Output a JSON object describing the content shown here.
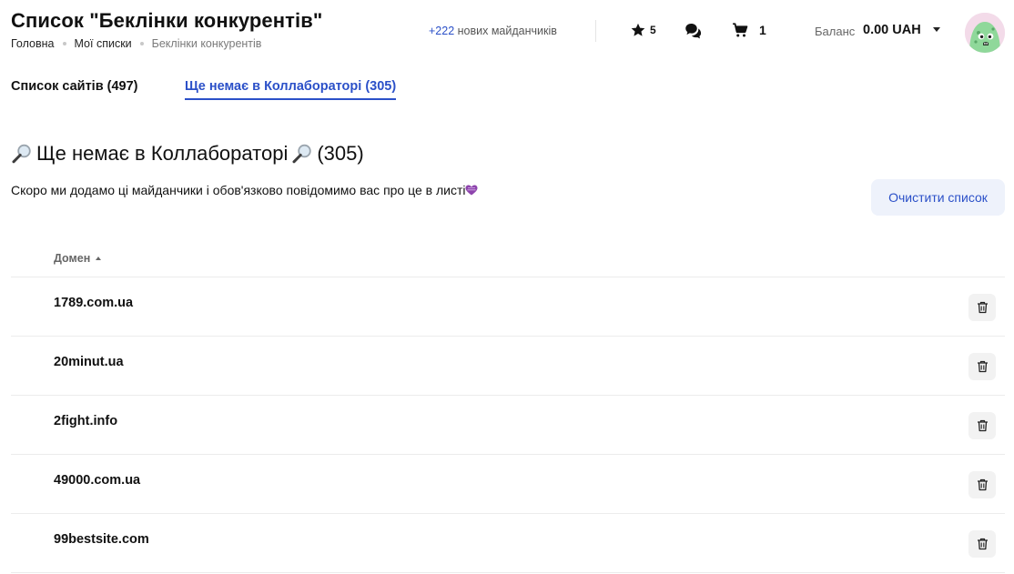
{
  "header": {
    "title": "Список \"Беклінки конкурентів\"",
    "breadcrumb": [
      "Головна",
      "Мої списки",
      "Беклінки конкурентів"
    ],
    "new_sites_count": "+222",
    "new_sites_text": "нових майданчиків",
    "favorites_count": "5",
    "cart_count": "1",
    "balance_label": "Баланс",
    "balance_value": "0.00 UAH",
    "icons": {
      "favorites": "star-icon",
      "chat": "chat-bubbles-icon",
      "cart": "cart-icon",
      "balance_dropdown": "caret-down-icon",
      "avatar": "monster-avatar"
    }
  },
  "tabs": [
    {
      "label": "Список сайтів (497)",
      "active": false
    },
    {
      "label": "Ще немає в Коллабораторі (305)",
      "active": true
    }
  ],
  "section": {
    "title_main": "Ще немає в Коллабораторі",
    "title_count": "(305)",
    "title_icon": "magnifier-emoji-icon",
    "description": "Скоро ми додамо ці майданчики і обов'язково повідомимо вас про це в листі",
    "description_icon": "heart-emoji-icon",
    "clear_button": "Очистити список"
  },
  "table": {
    "column_domain": "Домен",
    "rows": [
      {
        "domain": "1789.com.ua"
      },
      {
        "domain": "20minut.ua"
      },
      {
        "domain": "2fight.info"
      },
      {
        "domain": "49000.com.ua"
      },
      {
        "domain": "99bestsite.com"
      }
    ]
  },
  "colors": {
    "accent": "#2b50c8",
    "button_bg": "#eef2fb",
    "divider": "#ececec"
  }
}
